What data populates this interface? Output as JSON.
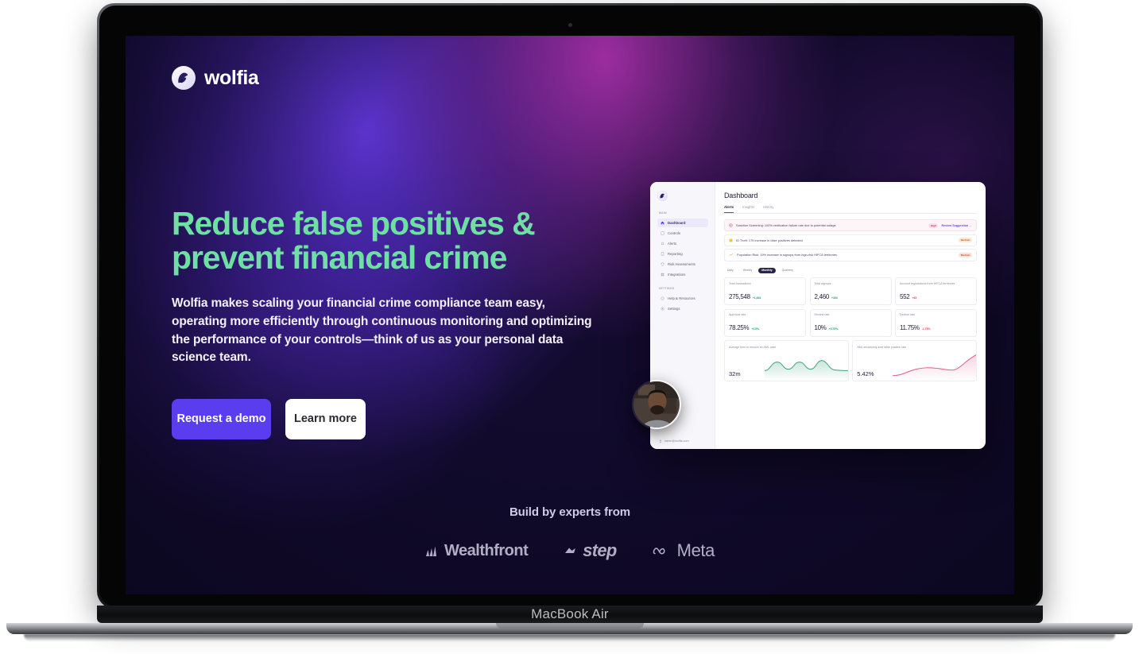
{
  "brand": {
    "name": "wolfia",
    "logo_icon": "wolf-logo-icon"
  },
  "hero": {
    "headline_line1": "Reduce false positives &",
    "headline_line2": "prevent financial crime",
    "subcopy": "Wolfia makes scaling your financial crime compliance team easy, operating more efficiently through continuous monitoring and optimizing the performance of your controls—think of us as your personal data science team.",
    "primary_cta": "Request a demo",
    "secondary_cta": "Learn more",
    "headline_color": "#6fe0a3",
    "primary_cta_color": "#5b3df0"
  },
  "experts": {
    "label": "Build by experts from",
    "logos": [
      {
        "name": "Wealthfront",
        "icon": "wealthfront-icon"
      },
      {
        "name": "step",
        "icon": "step-icon"
      },
      {
        "name": "Meta",
        "icon": "meta-infinity-icon"
      }
    ]
  },
  "device": {
    "model_label": "MacBook Air"
  },
  "dashboard": {
    "sidebar": {
      "logo_icon": "wolf-logo-icon",
      "sections": [
        {
          "label": "Main",
          "items": [
            {
              "label": "Dashboard",
              "icon": "home-icon",
              "active": true
            },
            {
              "label": "Controls",
              "icon": "sliders-icon",
              "active": false
            },
            {
              "label": "Alerts",
              "icon": "bell-icon",
              "active": false
            },
            {
              "label": "Reporting",
              "icon": "document-icon",
              "active": false
            },
            {
              "label": "Risk Assessments",
              "icon": "shield-icon",
              "active": false
            },
            {
              "label": "Integrations",
              "icon": "grid-icon",
              "active": false
            }
          ]
        },
        {
          "label": "Settings",
          "items": [
            {
              "label": "Help & Resources",
              "icon": "question-icon",
              "active": false
            },
            {
              "label": "Settings",
              "icon": "gear-icon",
              "active": false
            }
          ]
        }
      ],
      "account_email": "naren@wolfia.com",
      "account_icon": "user-icon"
    },
    "page_title": "Dashboard",
    "tabs": [
      {
        "label": "Alerts",
        "active": true
      },
      {
        "label": "Insights",
        "active": false
      },
      {
        "label": "History",
        "active": false
      }
    ],
    "alerts": [
      {
        "icon": "alert-circle-icon",
        "text": "Sanction Screening: 100% verification failure rate due to potential outage",
        "severity": "High",
        "action": "Review Suggestion →"
      },
      {
        "icon": "warning-square-icon",
        "text": "ID Theft: 175 increase in false positives detected",
        "severity": "Medium",
        "action": ""
      },
      {
        "icon": "trend-up-icon",
        "text": "Population Risk: 19% increase in signups from high-risk HIFCA territories",
        "severity": "Medium",
        "action": ""
      }
    ],
    "range_chips": [
      {
        "label": "Daily",
        "active": false
      },
      {
        "label": "Weekly",
        "active": false
      },
      {
        "label": "Monthly",
        "active": true
      },
      {
        "label": "Quarterly",
        "active": false
      }
    ],
    "kpis": [
      {
        "label": "Total transactions",
        "value": "275,548",
        "delta": "+1,404",
        "direction": "up"
      },
      {
        "label": "Total signups",
        "value": "2,460",
        "delta": "+304",
        "direction": "up"
      },
      {
        "label": "Account registrations from HIFCA territories",
        "value": "552",
        "delta": "+45",
        "direction": "down"
      },
      {
        "label": "Approval rate",
        "value": "78.25%",
        "delta": "+2.5%",
        "direction": "up"
      },
      {
        "label": "Review rate",
        "value": "10%",
        "delta": "+0.75%",
        "direction": "up"
      },
      {
        "label": "Decline rate",
        "value": "11.75%",
        "delta": "-1.75%",
        "direction": "down"
      }
    ],
    "charts": [
      {
        "label": "Average time to resolve an AML case",
        "value": "32m",
        "color": "#3fa37a",
        "type": "area"
      },
      {
        "label": "AML structuring alert false positive rate",
        "value": "5.42%",
        "color": "#dc5c86",
        "type": "area"
      }
    ]
  },
  "chart_data": [
    {
      "type": "area",
      "title": "Average time to resolve an AML case",
      "value_label": "32m",
      "x": [
        0,
        1,
        2,
        3,
        4,
        5,
        6,
        7,
        8,
        9,
        10,
        11,
        12
      ],
      "values": [
        30,
        34,
        31,
        35,
        31,
        35,
        31,
        36,
        33,
        31,
        30,
        30,
        30
      ],
      "ylabel": "minutes",
      "color": "#3fa37a",
      "grid": false,
      "legend": "none"
    },
    {
      "type": "area",
      "title": "AML structuring alert false positive rate",
      "value_label": "5.42%",
      "x": [
        0,
        1,
        2,
        3,
        4,
        5,
        6,
        7,
        8,
        9,
        10,
        11,
        12
      ],
      "values": [
        2.0,
        2.1,
        2.5,
        3.2,
        3.8,
        4.0,
        4.0,
        3.8,
        3.7,
        4.2,
        5.0,
        5.3,
        5.42
      ],
      "ylabel": "percent",
      "color": "#dc5c86",
      "grid": false,
      "legend": "none"
    }
  ]
}
